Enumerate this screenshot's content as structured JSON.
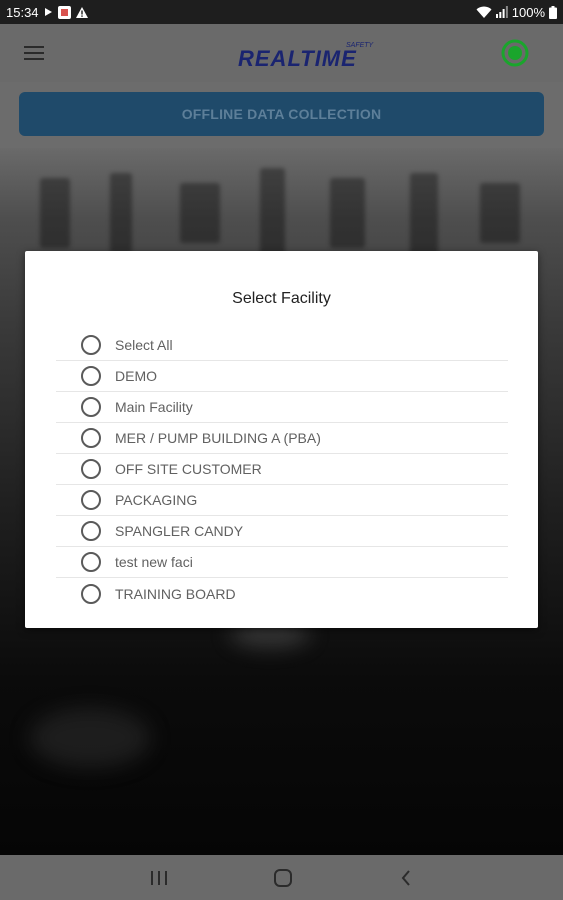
{
  "status_bar": {
    "time": "15:34",
    "battery": "100%"
  },
  "header": {
    "menu_icon": "hamburger-menu-icon",
    "logo_text": "REALTIME",
    "logo_tagline": "SAFETY",
    "status_icon": "connection-status-icon",
    "status_color": "#1aa52c"
  },
  "offline_button": {
    "label": "OFFLINE DATA COLLECTION",
    "color": "#1f4a6a"
  },
  "dialog": {
    "title": "Select Facility",
    "options": [
      "Select All",
      "DEMO",
      "Main Facility",
      "MER / PUMP BUILDING A (PBA)",
      "OFF SITE CUSTOMER",
      "PACKAGING",
      "SPANGLER CANDY",
      "test new faci",
      "TRAINING BOARD"
    ]
  },
  "nav_bar": {
    "recents_icon": "recents-icon",
    "home_icon": "home-icon",
    "back_icon": "back-icon"
  }
}
